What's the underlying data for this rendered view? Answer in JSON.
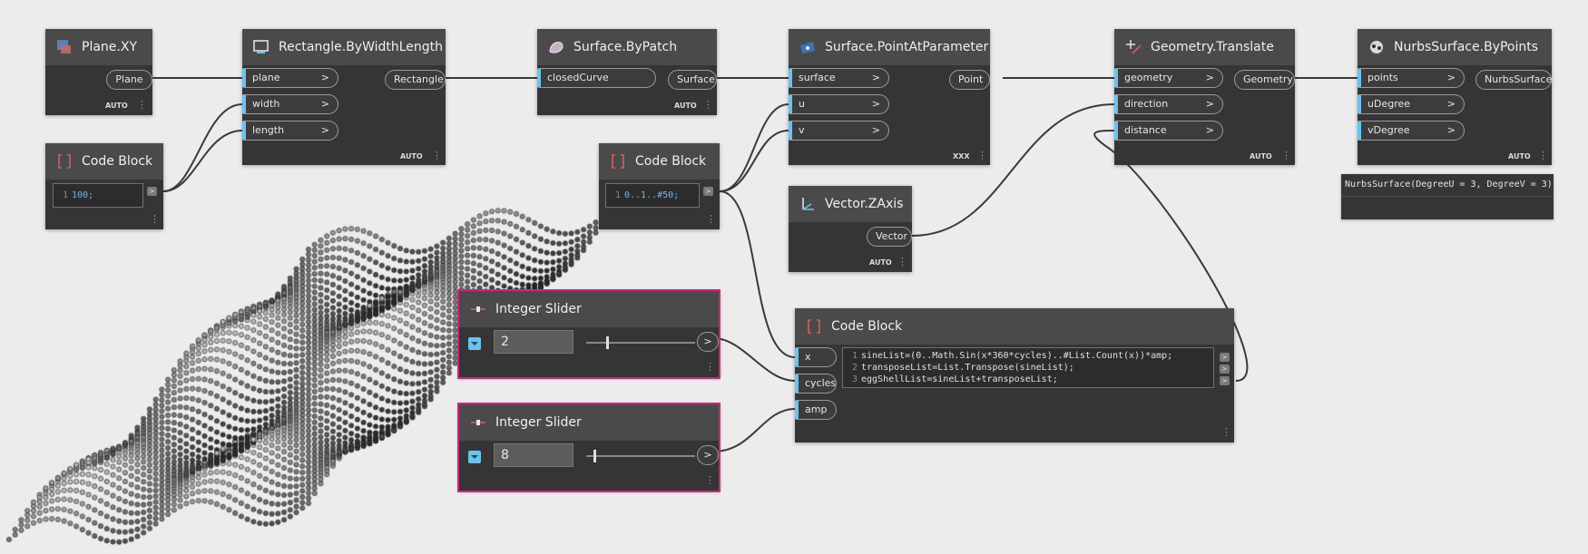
{
  "nodes": {
    "plane_xy": {
      "title": "Plane.XY",
      "output": "Plane",
      "lacing": "AUTO"
    },
    "rectangle": {
      "title": "Rectangle.ByWidthLength",
      "inputs": [
        "plane",
        "width",
        "length"
      ],
      "output": "Rectangle",
      "lacing": "AUTO"
    },
    "code_block_1": {
      "title": "Code Block",
      "line_no": "1",
      "code": "100;"
    },
    "surface_bypatch": {
      "title": "Surface.ByPatch",
      "input": "closedCurve",
      "output": "Surface",
      "lacing": "AUTO"
    },
    "code_block_2": {
      "title": "Code Block",
      "line_no": "1",
      "code": "0..1..#50;"
    },
    "point_at_param": {
      "title": "Surface.PointAtParameter",
      "inputs": [
        "surface",
        "u",
        "v"
      ],
      "output": "Point",
      "lacing": "XXX"
    },
    "vector_zaxis": {
      "title": "Vector.ZAxis",
      "output": "Vector",
      "lacing": "AUTO"
    },
    "geometry_translate": {
      "title": "Geometry.Translate",
      "inputs": [
        "geometry",
        "direction",
        "distance"
      ],
      "output": "Geometry",
      "lacing": "AUTO"
    },
    "nurbs_bypoints": {
      "title": "NurbsSurface.ByPoints",
      "inputs": [
        "points",
        "uDegree",
        "vDegree"
      ],
      "output": "NurbsSurface",
      "lacing": "AUTO"
    },
    "nurbs_preview": {
      "text": "NurbsSurface(DegreeU = 3, DegreeV = 3)"
    },
    "slider_1": {
      "title": "Integer Slider",
      "value": "2",
      "level": 0.18
    },
    "slider_2": {
      "title": "Integer Slider",
      "value": "8",
      "level": 0.07
    },
    "code_block_3": {
      "title": "Code Block",
      "inputs": [
        "x",
        "cycles",
        "amp"
      ],
      "lines": [
        {
          "n": "1",
          "code": "sineList=(0..Math.Sin(x*360*cycles)..#List.Count(x))*amp;"
        },
        {
          "n": "2",
          "code": "transposeList=List.Transpose(sineList);"
        },
        {
          "n": "3",
          "code": "eggShellList=sineList+transposeList;"
        }
      ]
    }
  },
  "arrow_glyph": ">",
  "colors": {
    "port_blue": "#6ac3ee",
    "selection": "#d2237c",
    "node_bg": "#353535",
    "header_bg": "#4a4a4a",
    "canvas": "#ececec"
  }
}
